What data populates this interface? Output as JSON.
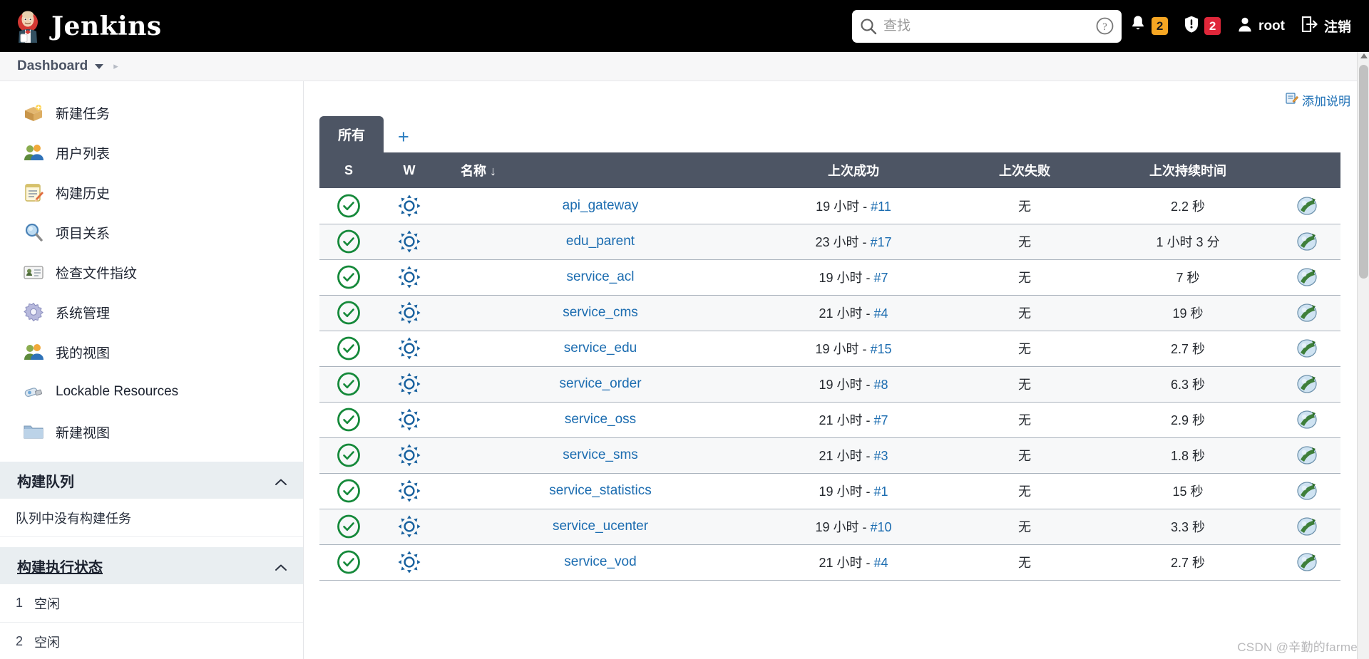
{
  "header": {
    "brand": "Jenkins",
    "logo_icon": "jenkins-butler-logo",
    "search": {
      "placeholder": "查找",
      "value": "",
      "icon": "search-icon",
      "help_icon": "help-circle-icon"
    },
    "notifications": {
      "icon": "bell-icon",
      "count": "2",
      "color": "#f5a623"
    },
    "security": {
      "icon": "shield-alert-icon",
      "count": "2",
      "color": "#e0273a"
    },
    "user": {
      "icon": "person-icon",
      "name": "root"
    },
    "logout": {
      "icon": "logout-arrow-icon",
      "label": "注销"
    }
  },
  "breadcrumb": {
    "root": "Dashboard",
    "caret_icon": "chevron-down-icon",
    "arrow_icon": "chevron-right-icon"
  },
  "sidebar": {
    "items": [
      {
        "label": "新建任务",
        "icon": "new-job-box-icon"
      },
      {
        "label": "用户列表",
        "icon": "users-icon"
      },
      {
        "label": "构建历史",
        "icon": "build-history-notepad-icon"
      },
      {
        "label": "项目关系",
        "icon": "magnifier-icon"
      },
      {
        "label": "检查文件指纹",
        "icon": "fingerprint-card-icon"
      },
      {
        "label": "系统管理",
        "icon": "gear-icon"
      },
      {
        "label": "我的视图",
        "icon": "users-icon"
      },
      {
        "label": "Lockable Resources",
        "icon": "usb-key-icon"
      },
      {
        "label": "新建视图",
        "icon": "folder-icon"
      }
    ],
    "build_queue": {
      "title": "构建队列",
      "collapse_icon": "chevron-up-icon",
      "empty_text": "队列中没有构建任务"
    },
    "build_executor": {
      "title": "构建执行状态",
      "collapse_icon": "chevron-up-icon",
      "executors": [
        {
          "num": "1",
          "status": "空闲"
        },
        {
          "num": "2",
          "status": "空闲"
        }
      ]
    }
  },
  "main": {
    "add_description": {
      "label": "添加说明",
      "icon": "edit-note-icon"
    },
    "tabs": [
      {
        "label": "所有",
        "active": true
      }
    ],
    "add_tab_label": "+",
    "table": {
      "columns": {
        "s": "S",
        "w": "W",
        "name": "名称",
        "sort_indicator": "↓",
        "last_success": "上次成功",
        "last_failure": "上次失败",
        "last_duration": "上次持续时间"
      },
      "rows": [
        {
          "status": "success",
          "weather": "sunny",
          "name": "api_gateway",
          "last_success_time": "19 小时",
          "last_success_build": "#11",
          "last_failure": "无",
          "duration": "2.2 秒",
          "action": "schedule-build-icon"
        },
        {
          "status": "success",
          "weather": "sunny",
          "name": "edu_parent",
          "last_success_time": "23 小时",
          "last_success_build": "#17",
          "last_failure": "无",
          "duration": "1 小时 3 分",
          "action": "schedule-build-icon"
        },
        {
          "status": "success",
          "weather": "sunny",
          "name": "service_acl",
          "last_success_time": "19 小时",
          "last_success_build": "#7",
          "last_failure": "无",
          "duration": "7 秒",
          "action": "schedule-build-icon"
        },
        {
          "status": "success",
          "weather": "sunny",
          "name": "service_cms",
          "last_success_time": "21 小时",
          "last_success_build": "#4",
          "last_failure": "无",
          "duration": "19 秒",
          "action": "schedule-build-icon"
        },
        {
          "status": "success",
          "weather": "sunny",
          "name": "service_edu",
          "last_success_time": "19 小时",
          "last_success_build": "#15",
          "last_failure": "无",
          "duration": "2.7 秒",
          "action": "schedule-build-icon"
        },
        {
          "status": "success",
          "weather": "sunny",
          "name": "service_order",
          "last_success_time": "19 小时",
          "last_success_build": "#8",
          "last_failure": "无",
          "duration": "6.3 秒",
          "action": "schedule-build-icon"
        },
        {
          "status": "success",
          "weather": "sunny",
          "name": "service_oss",
          "last_success_time": "21 小时",
          "last_success_build": "#7",
          "last_failure": "无",
          "duration": "2.9 秒",
          "action": "schedule-build-icon"
        },
        {
          "status": "success",
          "weather": "sunny",
          "name": "service_sms",
          "last_success_time": "21 小时",
          "last_success_build": "#3",
          "last_failure": "无",
          "duration": "1.8 秒",
          "action": "schedule-build-icon"
        },
        {
          "status": "success",
          "weather": "sunny",
          "name": "service_statistics",
          "last_success_time": "19 小时",
          "last_success_build": "#1",
          "last_failure": "无",
          "duration": "15 秒",
          "action": "schedule-build-icon"
        },
        {
          "status": "success",
          "weather": "sunny",
          "name": "service_ucenter",
          "last_success_time": "19 小时",
          "last_success_build": "#10",
          "last_failure": "无",
          "duration": "3.3 秒",
          "action": "schedule-build-icon"
        },
        {
          "status": "success",
          "weather": "sunny",
          "name": "service_vod",
          "last_success_time": "21 小时",
          "last_success_build": "#4",
          "last_failure": "无",
          "duration": "2.7 秒",
          "action": "schedule-build-icon"
        }
      ]
    }
  },
  "watermark": "CSDN @辛勤的farmer",
  "colors": {
    "header_bg": "#000000",
    "table_header_bg": "#4d5564",
    "link_blue": "#1b6cb0",
    "success_green": "#15893a",
    "badge_orange": "#f5a623",
    "badge_red": "#e0273a"
  }
}
